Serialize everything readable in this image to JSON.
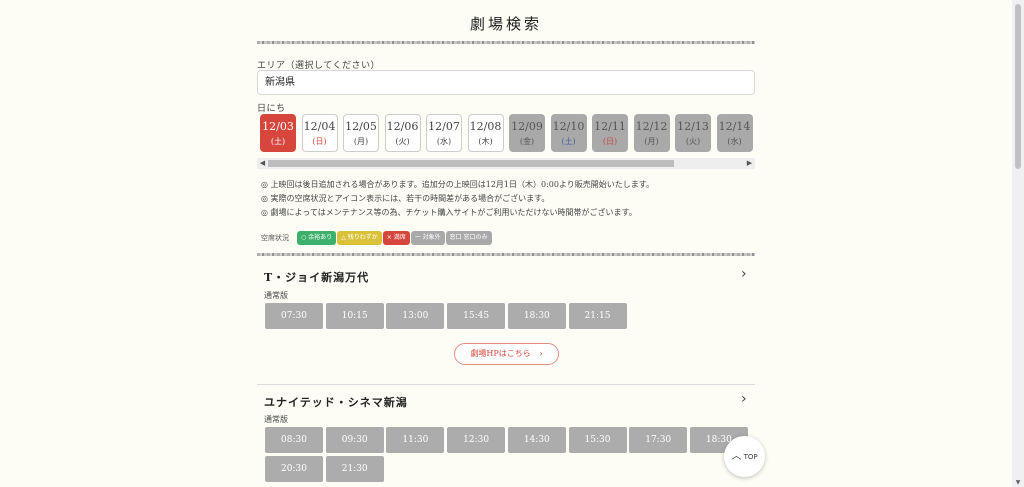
{
  "page_title": "劇場検索",
  "area": {
    "label": "エリア（選択してください）",
    "value": "新潟県"
  },
  "dates_label": "日にち",
  "dates": [
    {
      "date": "12/03",
      "dow": "(土)",
      "state": "selected",
      "dow_type": "sat"
    },
    {
      "date": "12/04",
      "dow": "(日)",
      "state": "available",
      "dow_type": "sun"
    },
    {
      "date": "12/05",
      "dow": "(月)",
      "state": "available",
      "dow_type": ""
    },
    {
      "date": "12/06",
      "dow": "(火)",
      "state": "available",
      "dow_type": ""
    },
    {
      "date": "12/07",
      "dow": "(水)",
      "state": "available",
      "dow_type": ""
    },
    {
      "date": "12/08",
      "dow": "(木)",
      "state": "available",
      "dow_type": ""
    },
    {
      "date": "12/09",
      "dow": "(金)",
      "state": "off",
      "dow_type": ""
    },
    {
      "date": "12/10",
      "dow": "(土)",
      "state": "off",
      "dow_type": "sat"
    },
    {
      "date": "12/11",
      "dow": "(日)",
      "state": "off",
      "dow_type": "sun"
    },
    {
      "date": "12/12",
      "dow": "(月)",
      "state": "off",
      "dow_type": ""
    },
    {
      "date": "12/13",
      "dow": "(火)",
      "state": "off",
      "dow_type": ""
    },
    {
      "date": "12/14",
      "dow": "(水)",
      "state": "off",
      "dow_type": ""
    }
  ],
  "notes": [
    "◎ 上映回は後日追加される場合があります。追加分の上映回は12月1日（木）0:00より販売開始いたします。",
    "◎ 実際の空席状況とアイコン表示には、若干の時間差がある場合がございます。",
    "◎ 劇場によってはメンテナンス等の為、チケット購入サイトがご利用いただけない時間帯がございます。"
  ],
  "legend": {
    "label": "空席状況",
    "items": [
      {
        "text": "○ 余裕あり",
        "color": "#3db06b"
      },
      {
        "text": "△ 残りわずか",
        "color": "#d9c23a"
      },
      {
        "text": "× 満席",
        "color": "#d6463c"
      },
      {
        "text": "ー 対象外",
        "color": "#a9a9a9"
      },
      {
        "text": "窓口 窓口のみ",
        "color": "#a9a9a9"
      }
    ]
  },
  "theaters": [
    {
      "name": "T・ジョイ新潟万代",
      "format": "通常版",
      "times": [
        "07:30",
        "10:15",
        "13:00",
        "15:45",
        "18:30",
        "21:15"
      ],
      "hp_link": "劇場HPはこちら"
    },
    {
      "name": "ユナイテッド・シネマ新潟",
      "format": "通常版",
      "times": [
        "08:30",
        "09:30",
        "11:30",
        "12:30",
        "14:30",
        "15:30",
        "17:30",
        "18:30",
        "20:30",
        "21:30"
      ]
    }
  ],
  "top_button": "TOP",
  "colors": {
    "accent": "#d6463c",
    "background": "#fdfdf5",
    "showtime": "#acacac"
  }
}
